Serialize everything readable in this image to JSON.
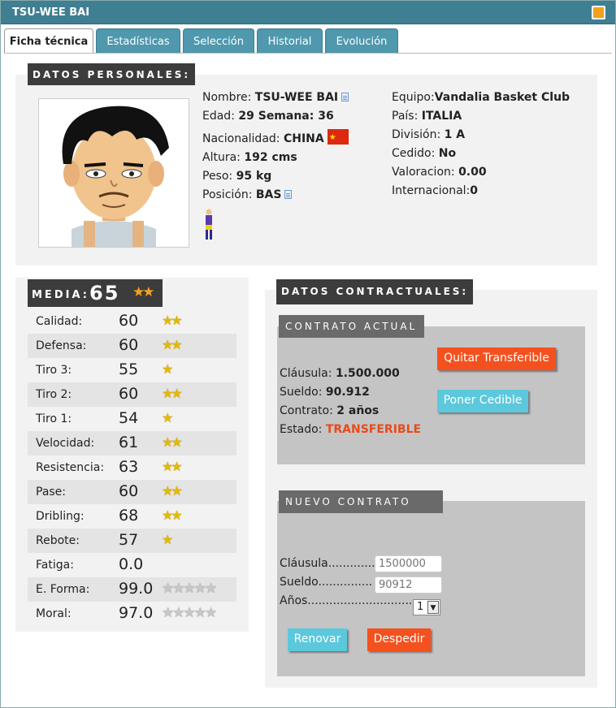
{
  "window": {
    "title": "TSU-WEE BAI"
  },
  "tabs": [
    "Ficha técnica",
    "Estadísticas",
    "Selección",
    "Historial",
    "Evolución"
  ],
  "personal": {
    "header": "DATOS PERSONALES:",
    "nombre_label": "Nombre:",
    "nombre": "TSU-WEE BAI",
    "edad_label": "Edad:",
    "edad": "29 Semana: 36",
    "nac_label": "Nacionalidad:",
    "nac": "CHINA",
    "altura_label": "Altura:",
    "altura": "192 cms",
    "peso_label": "Peso:",
    "peso": "95 kg",
    "pos_label": "Posición:",
    "pos": "BAS",
    "equipo_label": "Equipo:",
    "equipo": "Vandalia Basket Club",
    "pais_label": "País:",
    "pais": "ITALIA",
    "division_label": "División:",
    "division": "1 A",
    "cedido_label": "Cedido:",
    "cedido": "No",
    "valoracion_label": "Valoracion:",
    "valoracion": "0.00",
    "internacional_label": "Internacional:",
    "internacional": "0"
  },
  "media": {
    "label": "MEDIA:",
    "value": "65",
    "stars": "★★"
  },
  "stats": [
    {
      "label": "Calidad:",
      "value": "60",
      "stars": "★★"
    },
    {
      "label": "Defensa:",
      "value": "60",
      "stars": "★★"
    },
    {
      "label": "Tiro 3:",
      "value": "55",
      "stars": "★"
    },
    {
      "label": "Tiro 2:",
      "value": "60",
      "stars": "★★"
    },
    {
      "label": "Tiro 1:",
      "value": "54",
      "stars": "★"
    },
    {
      "label": "Velocidad:",
      "value": "61",
      "stars": "★★"
    },
    {
      "label": "Resistencia:",
      "value": "63",
      "stars": "★★"
    },
    {
      "label": "Pase:",
      "value": "60",
      "stars": "★★"
    },
    {
      "label": "Dribling:",
      "value": "68",
      "stars": "★★"
    },
    {
      "label": "Rebote:",
      "value": "57",
      "stars": "★"
    },
    {
      "label": "Fatiga:",
      "value": "0.0",
      "stars": ""
    },
    {
      "label": "E. Forma:",
      "value": "99.0",
      "stars": "★★★★★"
    },
    {
      "label": "Moral:",
      "value": "97.0",
      "stars": "★★★★★"
    }
  ],
  "contract": {
    "header": "DATOS CONTRACTUALES:",
    "actual_header": "CONTRATO ACTUAL",
    "clausula_label": "Cláusula:",
    "clausula": "1.500.000",
    "sueldo_label": "Sueldo:",
    "sueldo": "90.912",
    "contrato_label": "Contrato:",
    "contrato": "2 años",
    "estado_label": "Estado:",
    "estado": "TRANSFERIBLE",
    "btn_quitar": "Quitar Transferible",
    "btn_cedible": "Poner Cedible",
    "nuevo_header": "NUEVO CONTRATO",
    "n_clausula_label": "Cláusula.............",
    "n_clausula_placeholder": "1500000",
    "n_sueldo_label": "Sueldo...............",
    "n_sueldo_placeholder": "90912",
    "n_anios_label": "Años..............................",
    "n_anios_value": "1",
    "btn_renovar": "Renovar",
    "btn_despedir": "Despedir"
  }
}
